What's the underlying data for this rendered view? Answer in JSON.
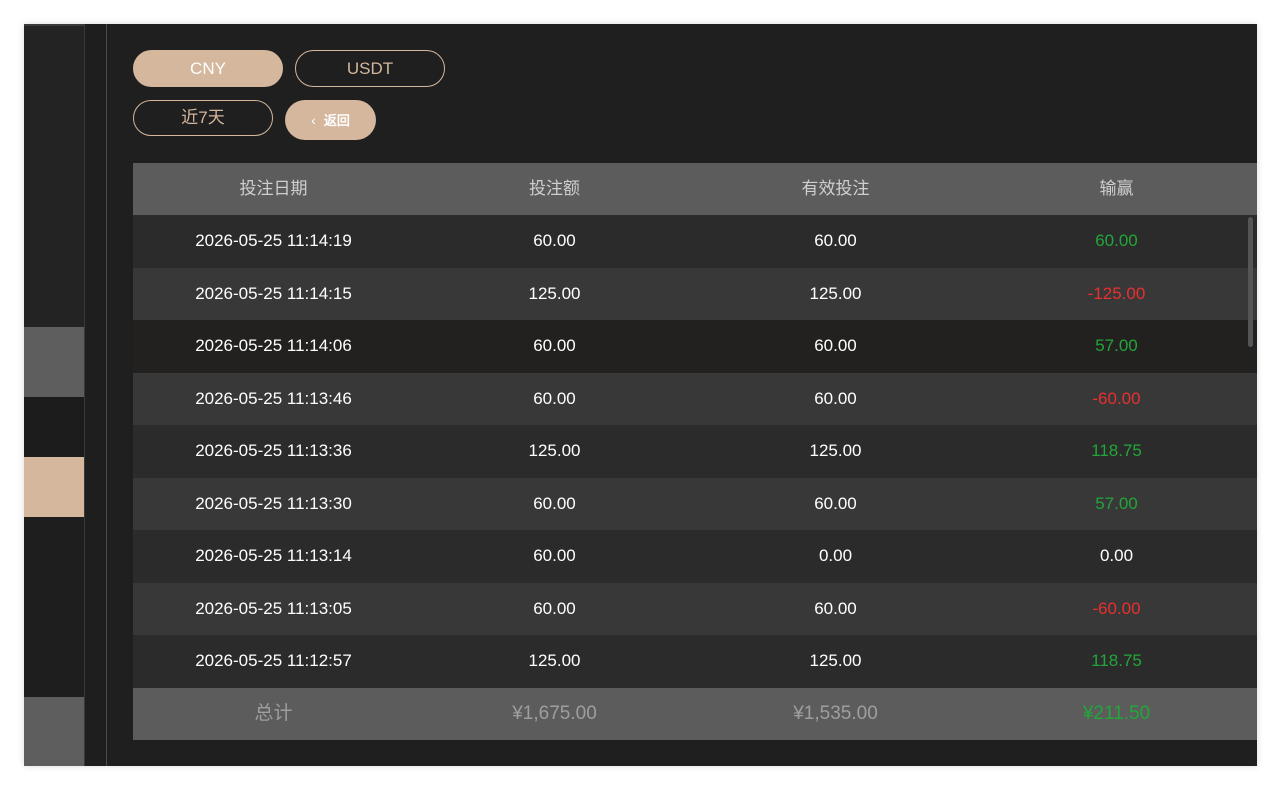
{
  "filters": {
    "currencies": [
      "CNY",
      "USDT"
    ],
    "selected_currency": "CNY",
    "range_label": "近7天",
    "back_label": "返回"
  },
  "table": {
    "columns": [
      "投注日期",
      "投注额",
      "有效投注",
      "输赢"
    ],
    "rows": [
      {
        "date": "2026-05-25 11:14:19",
        "bet": "60.00",
        "valid": "60.00",
        "winloss": "60.00",
        "sign": "pos"
      },
      {
        "date": "2026-05-25 11:14:15",
        "bet": "125.00",
        "valid": "125.00",
        "winloss": "-125.00",
        "sign": "neg"
      },
      {
        "date": "2026-05-25 11:14:06",
        "bet": "60.00",
        "valid": "60.00",
        "winloss": "57.00",
        "sign": "pos"
      },
      {
        "date": "2026-05-25 11:13:46",
        "bet": "60.00",
        "valid": "60.00",
        "winloss": "-60.00",
        "sign": "neg"
      },
      {
        "date": "2026-05-25 11:13:36",
        "bet": "125.00",
        "valid": "125.00",
        "winloss": "118.75",
        "sign": "pos"
      },
      {
        "date": "2026-05-25 11:13:30",
        "bet": "60.00",
        "valid": "60.00",
        "winloss": "57.00",
        "sign": "pos"
      },
      {
        "date": "2026-05-25 11:13:14",
        "bet": "60.00",
        "valid": "0.00",
        "winloss": "0.00",
        "sign": "zero"
      },
      {
        "date": "2026-05-25 11:13:05",
        "bet": "60.00",
        "valid": "60.00",
        "winloss": "-60.00",
        "sign": "neg"
      },
      {
        "date": "2026-05-25 11:12:57",
        "bet": "125.00",
        "valid": "125.00",
        "winloss": "118.75",
        "sign": "pos"
      }
    ],
    "totals": {
      "label": "总计",
      "bet": "¥1,675.00",
      "valid": "¥1,535.00",
      "winloss": "¥211.50"
    }
  },
  "colors": {
    "accent": "#d4b79c",
    "positive": "#22a63a",
    "negative": "#e83030"
  }
}
